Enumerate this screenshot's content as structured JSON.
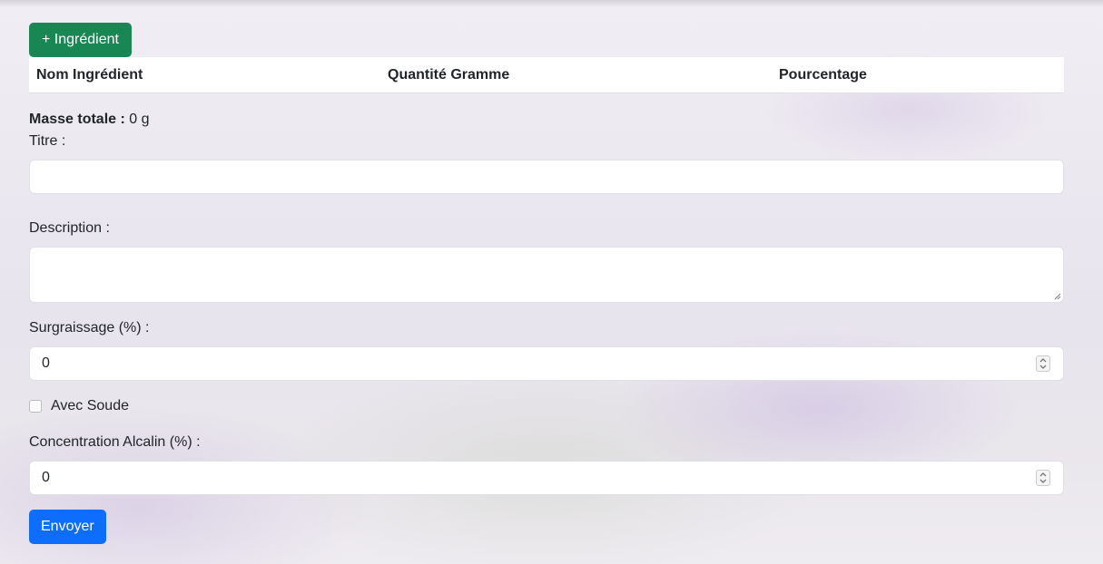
{
  "toolbar": {
    "add_ingredient_label": "+ Ingrédient"
  },
  "table": {
    "headers": [
      "Nom Ingrédient",
      "Quantité Gramme",
      "Pourcentage"
    ],
    "rows": []
  },
  "summary": {
    "total_mass_label": "Masse totale :",
    "total_mass_value": "0 g"
  },
  "form": {
    "title_label": "Titre :",
    "title_value": "",
    "description_label": "Description :",
    "description_value": "",
    "surgraissage_label": "Surgraissage (%) :",
    "surgraissage_value": "0",
    "soude_label": "Avec Soude",
    "soude_checked": false,
    "alcalin_label": "Concentration Alcalin (%) :",
    "alcalin_value": "0",
    "submit_label": "Envoyer"
  },
  "colors": {
    "add_button": "#198754",
    "submit_button": "#0d6efd"
  }
}
